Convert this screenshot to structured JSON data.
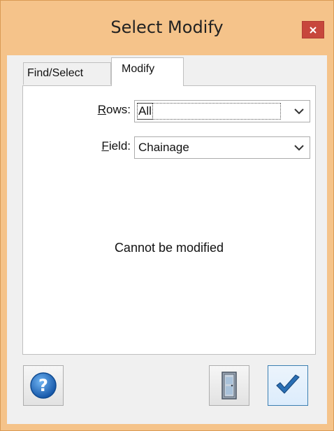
{
  "window": {
    "title": "Select Modify"
  },
  "tabs": [
    {
      "label": "Find/Select",
      "active": false
    },
    {
      "label": "Modify",
      "active": true
    }
  ],
  "form": {
    "rows": {
      "label_underlined": "R",
      "label_rest": "ows:",
      "value": "All"
    },
    "field": {
      "label_underlined": "F",
      "label_rest": "ield:",
      "value": "Chainage"
    }
  },
  "message": "Cannot be modified",
  "icons": {
    "close": "close-icon",
    "help": "help-icon",
    "exit": "door-icon",
    "ok": "checkmark-icon"
  },
  "colors": {
    "frame": "#f5c38a",
    "close_button": "#c7473c",
    "help_blue": "#1f6fc8",
    "check_blue": "#2a6fb5"
  }
}
